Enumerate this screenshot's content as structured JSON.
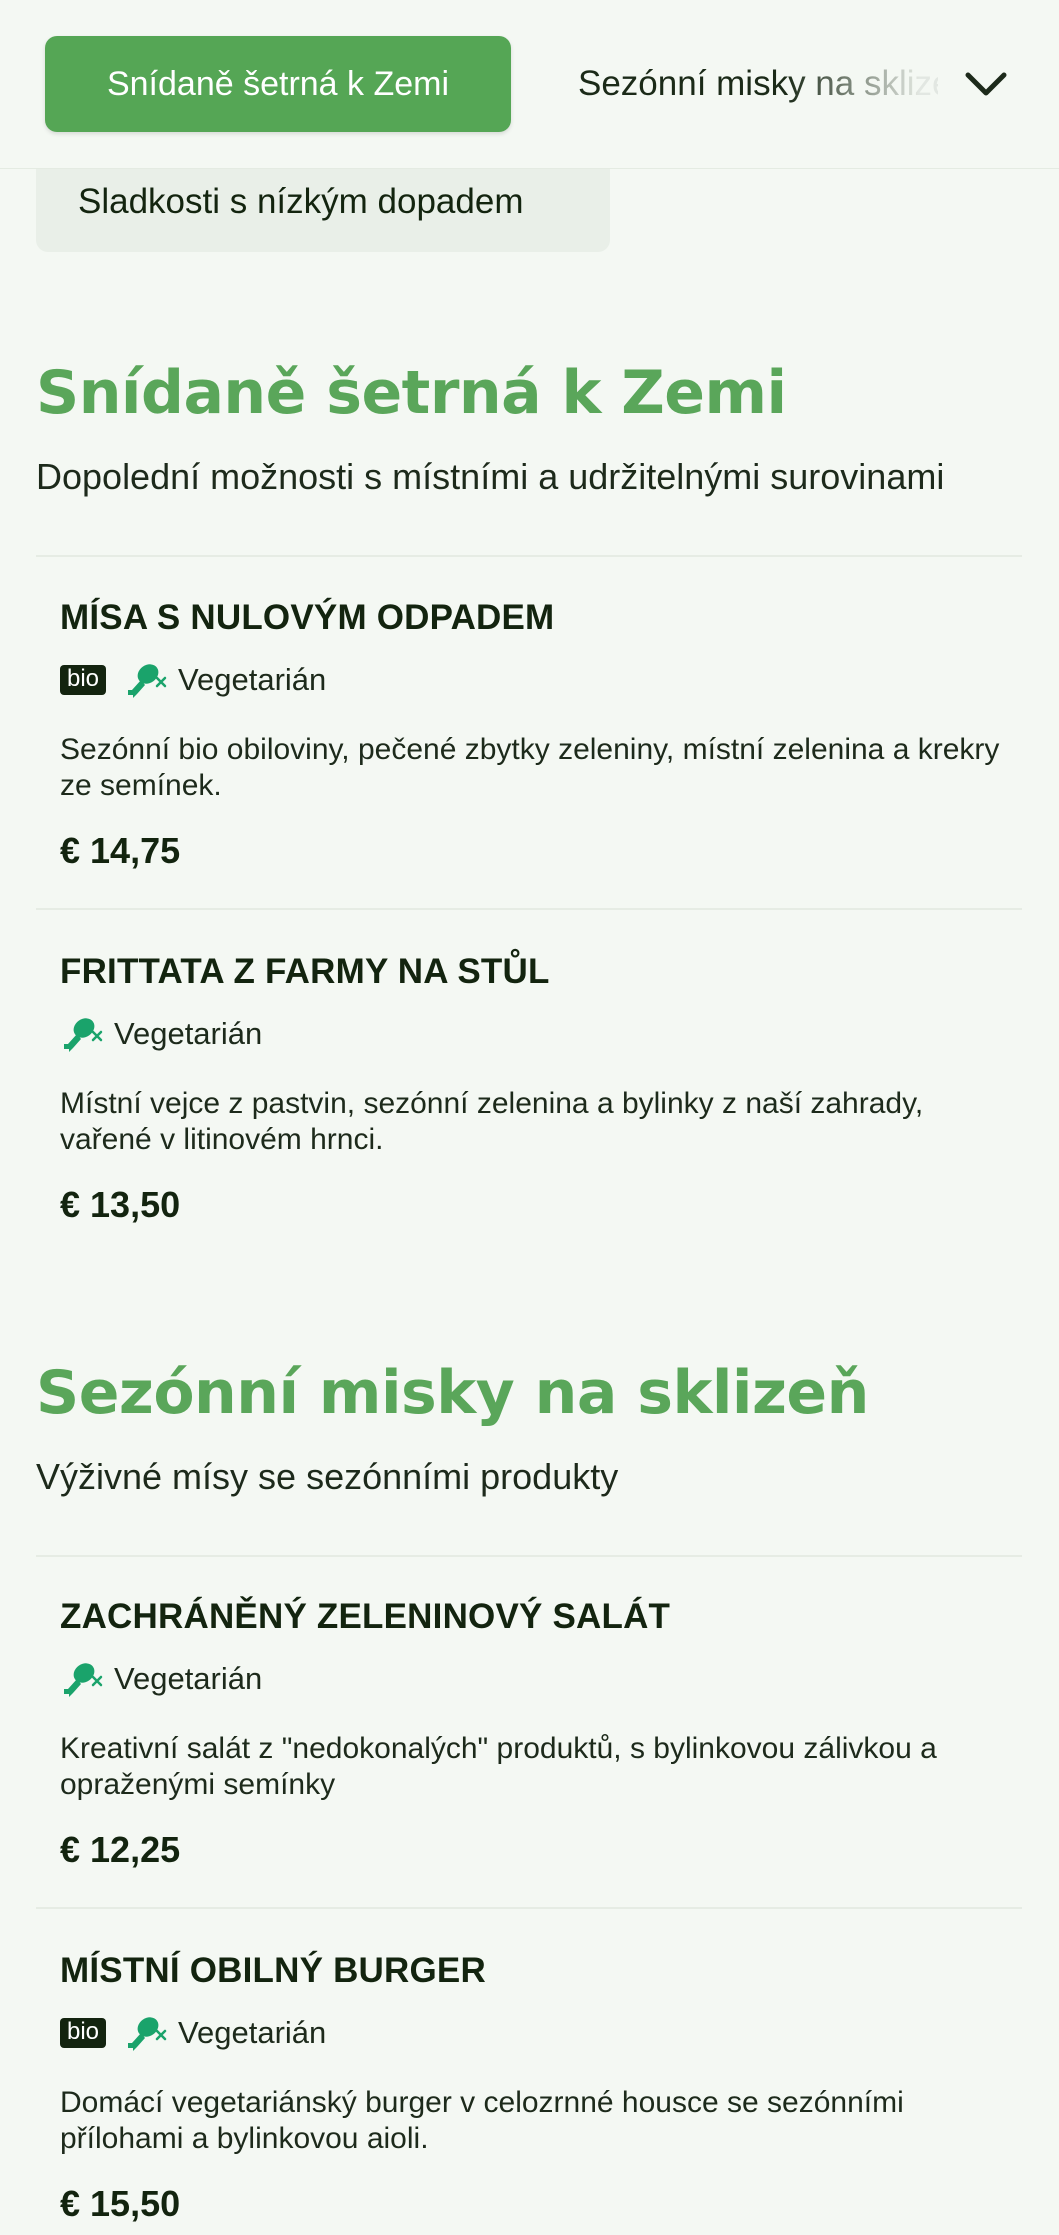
{
  "tabs": {
    "active_label": "Snídaně šetrná k Zemi",
    "next_label": "Sezónní misky na sklizeň",
    "row2_label": "Sladkosti s nízkým dopadem"
  },
  "sections": [
    {
      "title": "Snídaně šetrná k Zemi",
      "subtitle": "Dopolední možnosti s místními a udržitelnými surovinami",
      "items": [
        {
          "name": "MÍSA S NULOVÝM ODPADEM",
          "bio": "bio",
          "diet": "Vegetarián",
          "description": "Sezónní bio obiloviny, pečené zbytky zeleniny, místní zelenina a krekry ze semínek.",
          "price": "€ 14,75"
        },
        {
          "name": "FRITTATA Z FARMY NA STŮL",
          "diet": "Vegetarián",
          "description": "Místní vejce z pastvin, sezónní zelenina a bylinky z naší zahrady, vařené v litinovém hrnci.",
          "price": "€ 13,50"
        }
      ]
    },
    {
      "title": "Sezónní misky na sklizeň",
      "subtitle": "Výživné mísy se sezónními produkty",
      "items": [
        {
          "name": "ZACHRÁNĚNÝ ZELENINOVÝ SALÁT",
          "diet": "Vegetarián",
          "description": "Kreativní salát z \"nedokonalých\" produktů, s bylinkovou zálivkou a opraženými semínky",
          "price": "€ 12,25"
        },
        {
          "name": "MÍSTNÍ OBILNÝ BURGER",
          "bio": "bio",
          "diet": "Vegetarián",
          "description": "Domácí vegetariánský burger v celozrnné housce se sezónními přílohami a bylinkovou aioli.",
          "price": "€ 15,50"
        }
      ]
    }
  ],
  "colors": {
    "accent": "#55a655",
    "title_green": "#5aa65a",
    "veg_icon": "#1aa36b",
    "background": "#f4f8f3",
    "text": "#13240f"
  },
  "icons": {
    "dropdown": "chevron-down-icon",
    "diet": "vegetarian-drumstick-crossed-icon"
  }
}
